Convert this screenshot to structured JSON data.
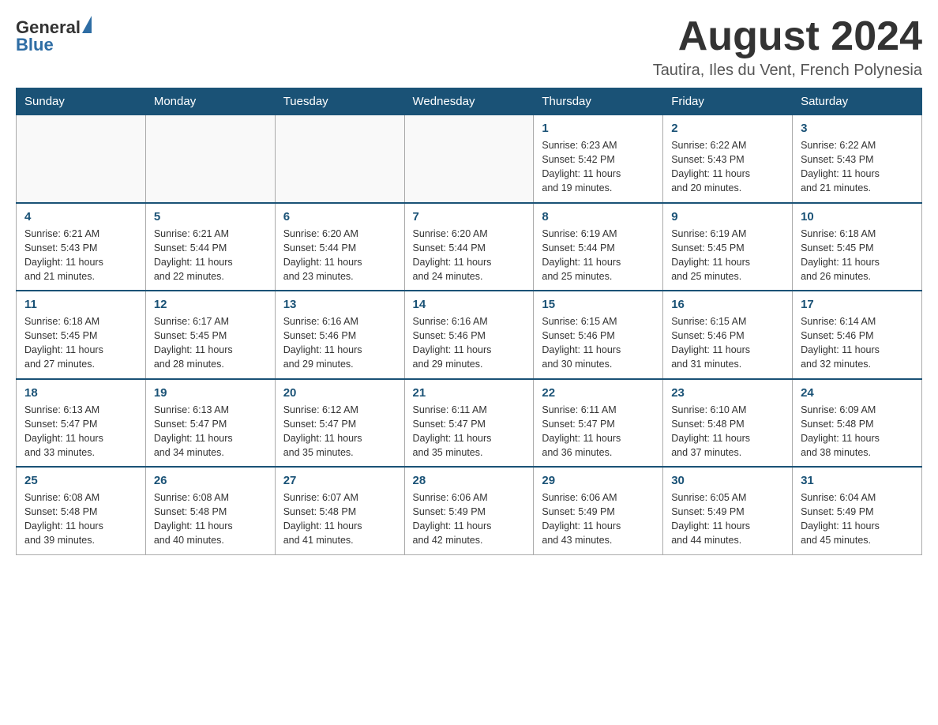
{
  "header": {
    "logo_general": "General",
    "logo_blue": "Blue",
    "month_title": "August 2024",
    "location": "Tautira, Iles du Vent, French Polynesia"
  },
  "days_of_week": [
    "Sunday",
    "Monday",
    "Tuesday",
    "Wednesday",
    "Thursday",
    "Friday",
    "Saturday"
  ],
  "weeks": [
    [
      {
        "day": "",
        "info": ""
      },
      {
        "day": "",
        "info": ""
      },
      {
        "day": "",
        "info": ""
      },
      {
        "day": "",
        "info": ""
      },
      {
        "day": "1",
        "info": "Sunrise: 6:23 AM\nSunset: 5:42 PM\nDaylight: 11 hours\nand 19 minutes."
      },
      {
        "day": "2",
        "info": "Sunrise: 6:22 AM\nSunset: 5:43 PM\nDaylight: 11 hours\nand 20 minutes."
      },
      {
        "day": "3",
        "info": "Sunrise: 6:22 AM\nSunset: 5:43 PM\nDaylight: 11 hours\nand 21 minutes."
      }
    ],
    [
      {
        "day": "4",
        "info": "Sunrise: 6:21 AM\nSunset: 5:43 PM\nDaylight: 11 hours\nand 21 minutes."
      },
      {
        "day": "5",
        "info": "Sunrise: 6:21 AM\nSunset: 5:44 PM\nDaylight: 11 hours\nand 22 minutes."
      },
      {
        "day": "6",
        "info": "Sunrise: 6:20 AM\nSunset: 5:44 PM\nDaylight: 11 hours\nand 23 minutes."
      },
      {
        "day": "7",
        "info": "Sunrise: 6:20 AM\nSunset: 5:44 PM\nDaylight: 11 hours\nand 24 minutes."
      },
      {
        "day": "8",
        "info": "Sunrise: 6:19 AM\nSunset: 5:44 PM\nDaylight: 11 hours\nand 25 minutes."
      },
      {
        "day": "9",
        "info": "Sunrise: 6:19 AM\nSunset: 5:45 PM\nDaylight: 11 hours\nand 25 minutes."
      },
      {
        "day": "10",
        "info": "Sunrise: 6:18 AM\nSunset: 5:45 PM\nDaylight: 11 hours\nand 26 minutes."
      }
    ],
    [
      {
        "day": "11",
        "info": "Sunrise: 6:18 AM\nSunset: 5:45 PM\nDaylight: 11 hours\nand 27 minutes."
      },
      {
        "day": "12",
        "info": "Sunrise: 6:17 AM\nSunset: 5:45 PM\nDaylight: 11 hours\nand 28 minutes."
      },
      {
        "day": "13",
        "info": "Sunrise: 6:16 AM\nSunset: 5:46 PM\nDaylight: 11 hours\nand 29 minutes."
      },
      {
        "day": "14",
        "info": "Sunrise: 6:16 AM\nSunset: 5:46 PM\nDaylight: 11 hours\nand 29 minutes."
      },
      {
        "day": "15",
        "info": "Sunrise: 6:15 AM\nSunset: 5:46 PM\nDaylight: 11 hours\nand 30 minutes."
      },
      {
        "day": "16",
        "info": "Sunrise: 6:15 AM\nSunset: 5:46 PM\nDaylight: 11 hours\nand 31 minutes."
      },
      {
        "day": "17",
        "info": "Sunrise: 6:14 AM\nSunset: 5:46 PM\nDaylight: 11 hours\nand 32 minutes."
      }
    ],
    [
      {
        "day": "18",
        "info": "Sunrise: 6:13 AM\nSunset: 5:47 PM\nDaylight: 11 hours\nand 33 minutes."
      },
      {
        "day": "19",
        "info": "Sunrise: 6:13 AM\nSunset: 5:47 PM\nDaylight: 11 hours\nand 34 minutes."
      },
      {
        "day": "20",
        "info": "Sunrise: 6:12 AM\nSunset: 5:47 PM\nDaylight: 11 hours\nand 35 minutes."
      },
      {
        "day": "21",
        "info": "Sunrise: 6:11 AM\nSunset: 5:47 PM\nDaylight: 11 hours\nand 35 minutes."
      },
      {
        "day": "22",
        "info": "Sunrise: 6:11 AM\nSunset: 5:47 PM\nDaylight: 11 hours\nand 36 minutes."
      },
      {
        "day": "23",
        "info": "Sunrise: 6:10 AM\nSunset: 5:48 PM\nDaylight: 11 hours\nand 37 minutes."
      },
      {
        "day": "24",
        "info": "Sunrise: 6:09 AM\nSunset: 5:48 PM\nDaylight: 11 hours\nand 38 minutes."
      }
    ],
    [
      {
        "day": "25",
        "info": "Sunrise: 6:08 AM\nSunset: 5:48 PM\nDaylight: 11 hours\nand 39 minutes."
      },
      {
        "day": "26",
        "info": "Sunrise: 6:08 AM\nSunset: 5:48 PM\nDaylight: 11 hours\nand 40 minutes."
      },
      {
        "day": "27",
        "info": "Sunrise: 6:07 AM\nSunset: 5:48 PM\nDaylight: 11 hours\nand 41 minutes."
      },
      {
        "day": "28",
        "info": "Sunrise: 6:06 AM\nSunset: 5:49 PM\nDaylight: 11 hours\nand 42 minutes."
      },
      {
        "day": "29",
        "info": "Sunrise: 6:06 AM\nSunset: 5:49 PM\nDaylight: 11 hours\nand 43 minutes."
      },
      {
        "day": "30",
        "info": "Sunrise: 6:05 AM\nSunset: 5:49 PM\nDaylight: 11 hours\nand 44 minutes."
      },
      {
        "day": "31",
        "info": "Sunrise: 6:04 AM\nSunset: 5:49 PM\nDaylight: 11 hours\nand 45 minutes."
      }
    ]
  ]
}
